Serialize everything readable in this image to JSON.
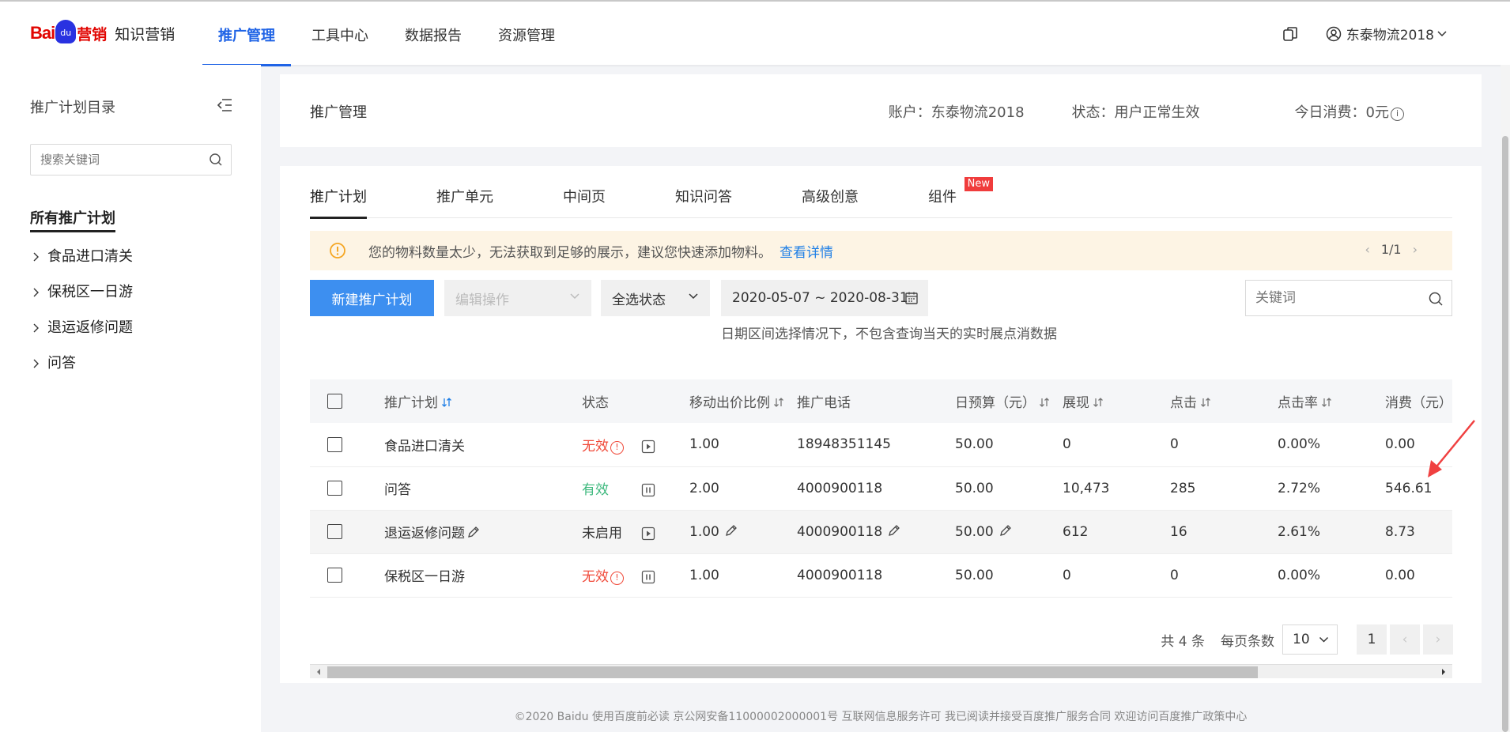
{
  "header": {
    "logo_bai": "Bai",
    "logo_du": "du",
    "logo_yingxiao": "营销",
    "logo_product": "知识营销",
    "nav": [
      {
        "label": "推广管理",
        "active": true
      },
      {
        "label": "工具中心",
        "active": false
      },
      {
        "label": "数据报告",
        "active": false
      },
      {
        "label": "资源管理",
        "active": false
      }
    ],
    "account_name": "东泰物流2018"
  },
  "sidebar": {
    "title": "推广计划目录",
    "search_placeholder": "搜索关键词",
    "all_label": "所有推广计划",
    "items": [
      "食品进口清关",
      "保税区一日游",
      "退运返修问题",
      "问答"
    ]
  },
  "info_bar": {
    "title": "推广管理",
    "account": "账户：东泰物流2018",
    "status": "状态：用户正常生效",
    "today_cost": "今日消费：0元"
  },
  "tabs": [
    {
      "label": "推广计划",
      "active": true
    },
    {
      "label": "推广单元",
      "active": false
    },
    {
      "label": "中间页",
      "active": false
    },
    {
      "label": "知识问答",
      "active": false
    },
    {
      "label": "高级创意",
      "active": false
    },
    {
      "label": "组件",
      "active": false,
      "badge": "New"
    }
  ],
  "notice": {
    "text": "您的物料数量太少，无法获取到足够的展示，建议您快速添加物料。",
    "link": "查看详情",
    "pager": "1/1"
  },
  "toolbar": {
    "new_button": "新建推广计划",
    "edit_select": "编辑操作",
    "status_select": "全选状态",
    "date_range": "2020-05-07 ~ 2020-08-31",
    "keyword_placeholder": "关键词",
    "date_hint": "日期区间选择情况下，不包含查询当天的实时展点消数据"
  },
  "table": {
    "columns": [
      "推广计划",
      "状态",
      "移动出价比例",
      "推广电话",
      "日预算（元）",
      "展现",
      "点击",
      "点击率",
      "消费（元）"
    ],
    "rows": [
      {
        "name": "食品进口清关",
        "status": "无效",
        "status_type": "bad",
        "control": "play",
        "ratio": "1.00",
        "phone": "18948351145",
        "budget": "50.00",
        "impr": "0",
        "clicks": "0",
        "ctr": "0.00%",
        "cost": "0.00"
      },
      {
        "name": "问答",
        "status": "有效",
        "status_type": "ok",
        "control": "pause",
        "ratio": "2.00",
        "phone": "4000900118",
        "budget": "50.00",
        "impr": "10,473",
        "clicks": "285",
        "ctr": "2.72%",
        "cost": "546.61"
      },
      {
        "name": "退运返修问题",
        "status": "未启用",
        "status_type": "off",
        "control": "play",
        "ratio": "1.00",
        "phone": "4000900118",
        "budget": "50.00",
        "impr": "612",
        "clicks": "16",
        "ctr": "2.61%",
        "cost": "8.73"
      },
      {
        "name": "保税区一日游",
        "status": "无效",
        "status_type": "bad",
        "control": "pause",
        "ratio": "1.00",
        "phone": "4000900118",
        "budget": "50.00",
        "impr": "0",
        "clicks": "0",
        "ctr": "0.00%",
        "cost": "0.00"
      }
    ]
  },
  "pagination": {
    "total": "共 4 条",
    "per_page_label": "每页条数",
    "per_page": "10",
    "current": "1"
  },
  "footer": "©2020 Baidu 使用百度前必读 京公网安备11000002000001号 互联网信息服务许可 我已阅读并接受百度推广服务合同 欢迎访问百度推广政策中心",
  "colors": {
    "primary": "#1f63e6",
    "button": "#3d8ff0",
    "invalid": "#f04a3a",
    "valid": "#3cb87c",
    "notice_bg": "#fdf4e4"
  }
}
